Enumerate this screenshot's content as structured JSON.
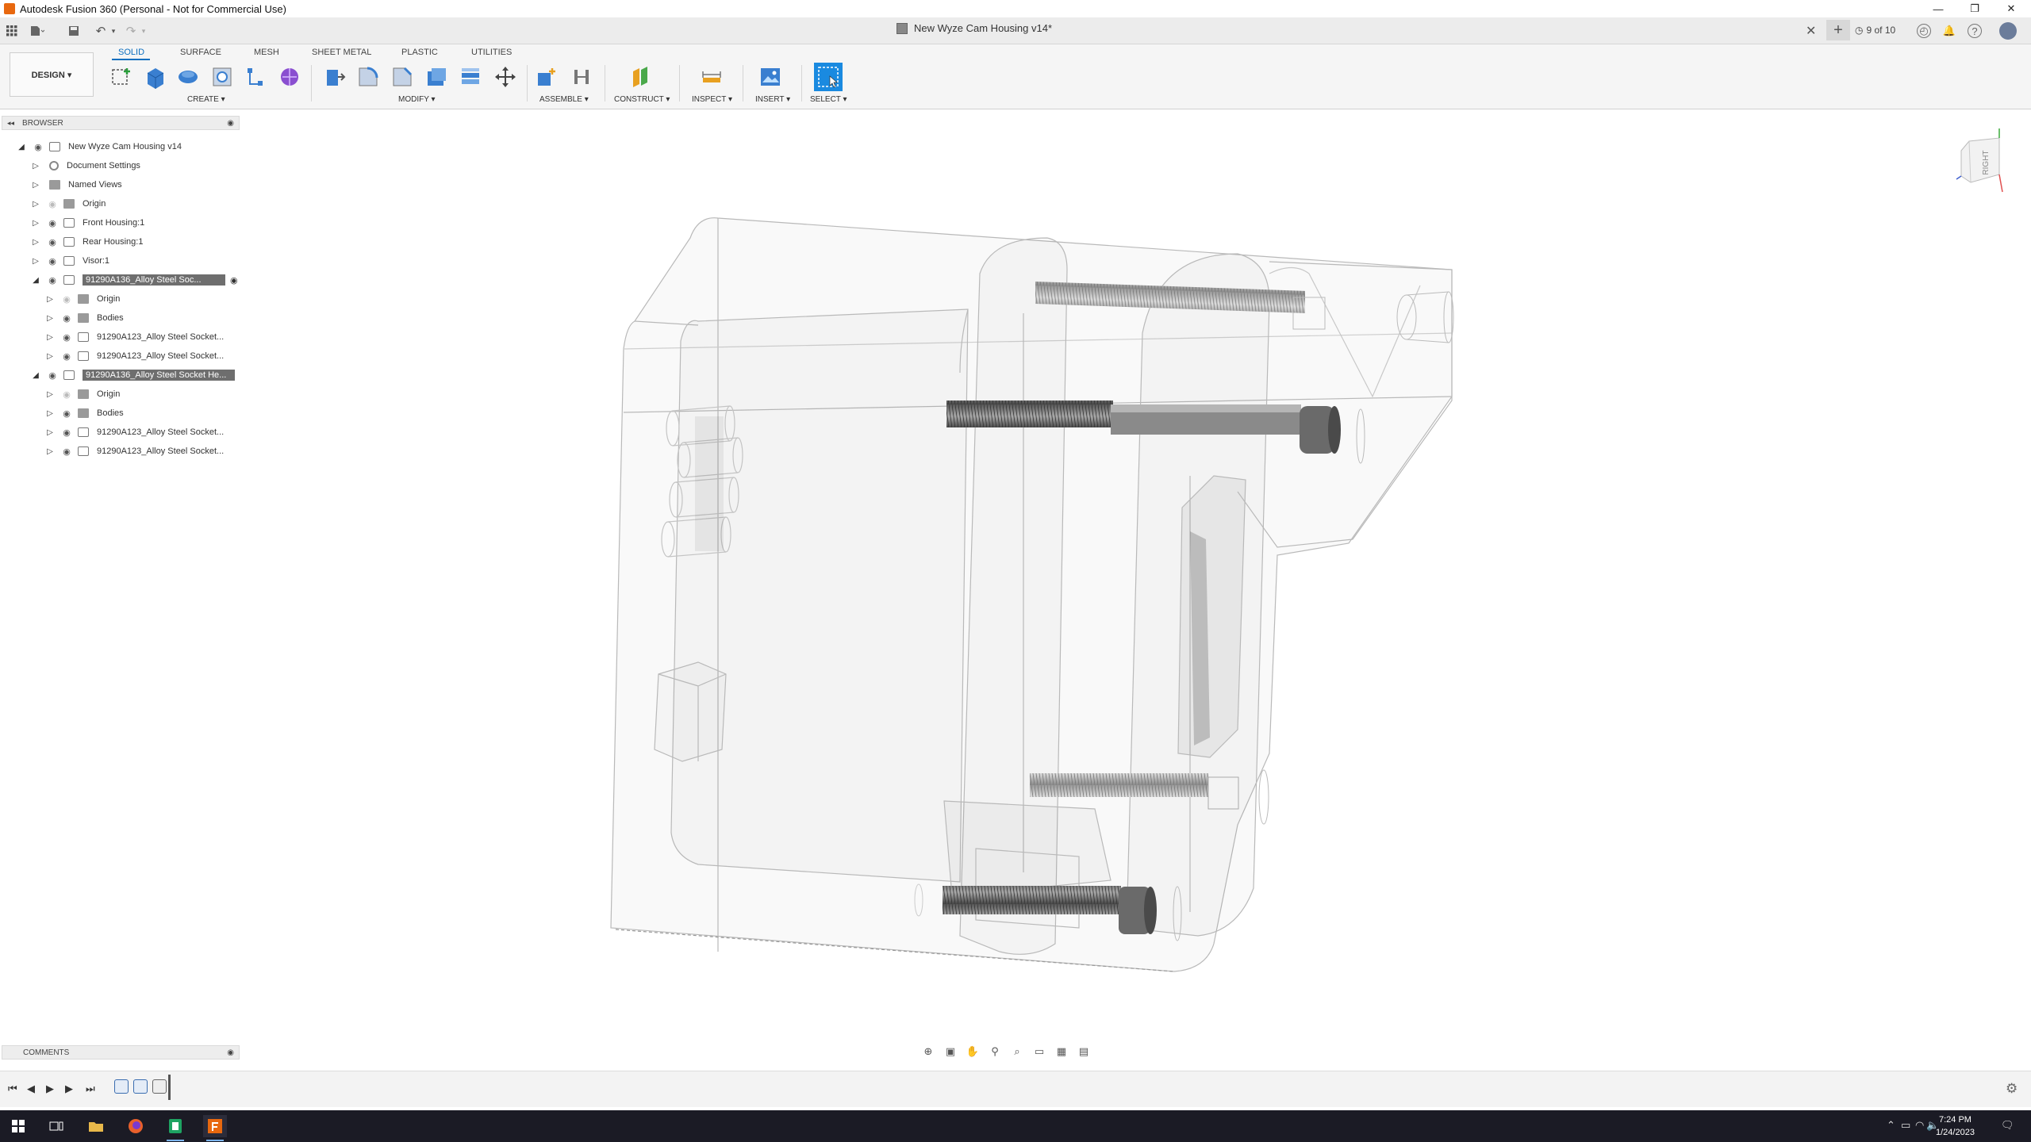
{
  "window": {
    "title": "Autodesk Fusion 360 (Personal - Not for Commercial Use)",
    "minimize": "—",
    "restore": "❐",
    "close": "✕"
  },
  "tabbar": {
    "doc_title": "New Wyze Cam Housing v14*",
    "close": "✕",
    "add": "+",
    "page_count": "9 of 10"
  },
  "toolbar": {
    "workspace": "DESIGN ▾",
    "tabs": [
      "SOLID",
      "SURFACE",
      "MESH",
      "SHEET METAL",
      "PLASTIC",
      "UTILITIES"
    ],
    "groups": [
      "CREATE ▾",
      "MODIFY ▾",
      "ASSEMBLE ▾",
      "CONSTRUCT ▾",
      "INSPECT ▾",
      "INSERT ▾",
      "SELECT ▾"
    ]
  },
  "browser": {
    "header": "BROWSER",
    "collapse": "◂◂",
    "items": [
      {
        "label": "New Wyze Cam Housing v14"
      },
      {
        "label": "Document Settings"
      },
      {
        "label": "Named Views"
      },
      {
        "label": "Origin"
      },
      {
        "label": "Front Housing:1"
      },
      {
        "label": "Rear Housing:1"
      },
      {
        "label": "Visor:1"
      },
      {
        "label": "91290A136_Alloy Steel Soc..."
      },
      {
        "label": "Origin"
      },
      {
        "label": "Bodies"
      },
      {
        "label": "91290A123_Alloy Steel Socket..."
      },
      {
        "label": "91290A123_Alloy Steel Socket..."
      },
      {
        "label": "91290A136_Alloy Steel Socket He..."
      },
      {
        "label": "Origin"
      },
      {
        "label": "Bodies"
      },
      {
        "label": "91290A123_Alloy Steel Socket..."
      },
      {
        "label": "91290A123_Alloy Steel Socket..."
      }
    ]
  },
  "viewcube": {
    "face": "RIGHT"
  },
  "comments": {
    "label": "COMMENTS"
  },
  "taskbar": {
    "time": "7:24 PM",
    "date": "1/24/2023"
  },
  "colors": {
    "accent": "#0d6fbf",
    "app_orange": "#e8680f",
    "selected_row": "#6e6e6e"
  }
}
